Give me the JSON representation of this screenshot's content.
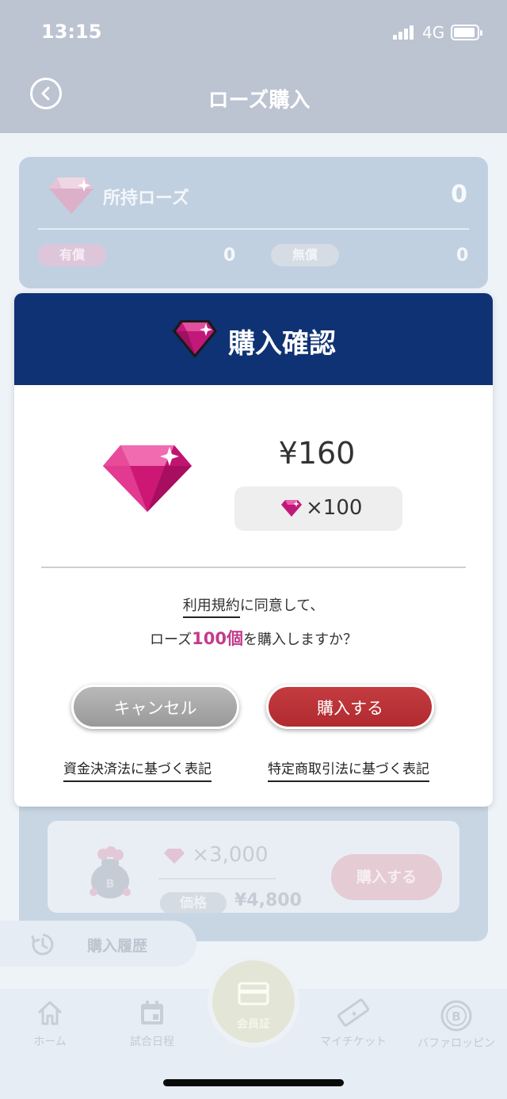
{
  "status_bar": {
    "time": "13:15",
    "network": "4G"
  },
  "header": {
    "title": "ローズ購入"
  },
  "holdings": {
    "label": "所持ローズ",
    "total": "0",
    "paid_label": "有償",
    "paid_value": "0",
    "free_label": "無償",
    "free_value": "0"
  },
  "product": {
    "amount": "×3,000",
    "price_label": "価格",
    "price": "¥4,800",
    "buy_label": "購入する"
  },
  "history": {
    "label": "購入履歴"
  },
  "modal": {
    "title": "購入確認",
    "price": "¥160",
    "quantity": "×100",
    "terms_link": "利用規約",
    "message_line1_rest": "に同意して、",
    "message_prefix": "ローズ",
    "message_highlight": "100個",
    "message_suffix": "を購入しますか？",
    "cancel_label": "キャンセル",
    "buy_label": "購入する",
    "legal_link_1": "資金決済法に基づく表記",
    "legal_link_2": "特定商取引法に基づく表記"
  },
  "nav": {
    "home": "ホーム",
    "schedule": "試合日程",
    "member": "会員証",
    "ticket": "マイチケット",
    "buffalo": "バファロッピン"
  },
  "colors": {
    "header_bg": "#bcc3d1",
    "modal_header": "#0f3274",
    "buy_button": "#b8302f",
    "cancel_button": "#a8a8a8",
    "highlight": "#c23c8c"
  }
}
